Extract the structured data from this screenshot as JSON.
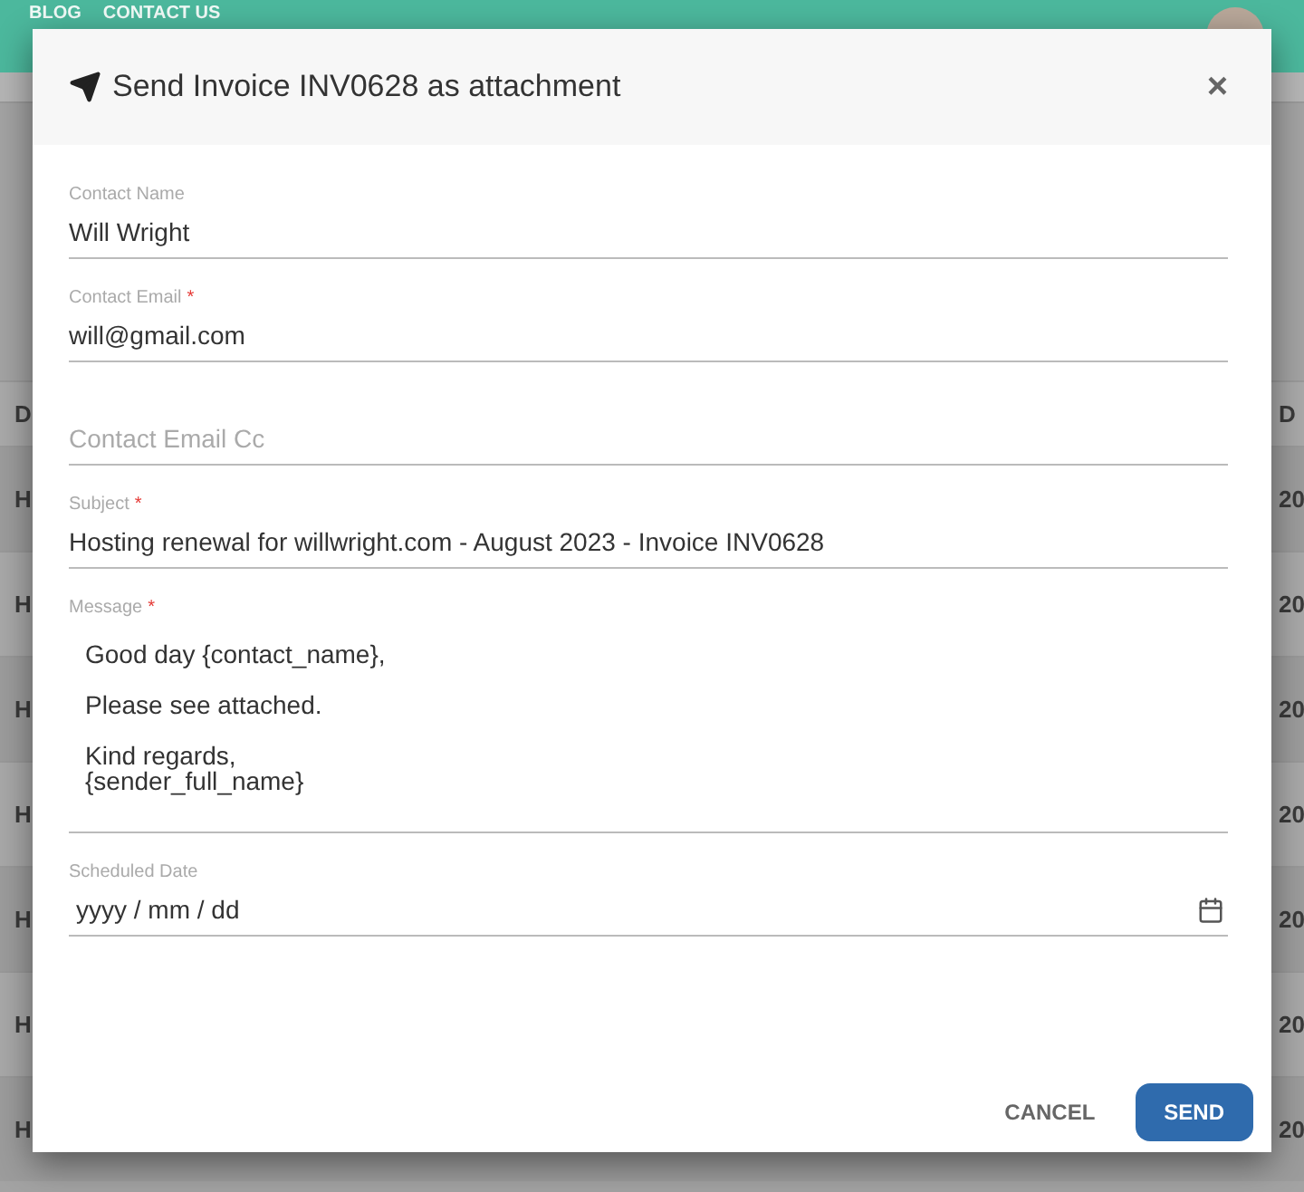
{
  "nav": {
    "links": [
      "BLOG",
      "CONTACT US"
    ]
  },
  "table": {
    "header": {
      "column_1": "D",
      "column_2": "D"
    },
    "rows": [
      {
        "column_1": "H",
        "column_2": "20"
      },
      {
        "column_1": "H",
        "column_2": "20"
      },
      {
        "column_1": "H",
        "column_2": "20"
      },
      {
        "column_1": "H",
        "column_2": "20"
      },
      {
        "column_1": "H",
        "column_2": "20"
      },
      {
        "column_1": "H",
        "column_2": "20"
      },
      {
        "column_1": "H",
        "column_2": "20"
      }
    ]
  },
  "dialog": {
    "title": "Send Invoice INV0628 as attachment",
    "close": "×",
    "fields": [
      {
        "kind": "text",
        "label": "Contact Name",
        "value": "Will Wright"
      },
      {
        "kind": "text",
        "label": "Contact Email",
        "required_mark": "*",
        "value": "will@gmail.com"
      },
      {
        "kind": "text",
        "placeholder": "Contact Email Cc"
      },
      {
        "kind": "text",
        "label": "Subject",
        "required_mark": "*",
        "value": "Hosting renewal for willwright.com - August 2023 - Invoice INV0628"
      },
      {
        "kind": "textarea",
        "label": "Message",
        "required_mark": "*",
        "value": "Good day {contact_name},\n\nPlease see attached.\n\nKind regards,\n{sender_full_name}"
      },
      {
        "kind": "date",
        "label": "Scheduled Date",
        "placeholder": "yyyy / mm / dd"
      }
    ],
    "buttons": [
      {
        "kind": "flat",
        "label": "CANCEL"
      },
      {
        "kind": "primary",
        "label": "SEND"
      }
    ]
  }
}
